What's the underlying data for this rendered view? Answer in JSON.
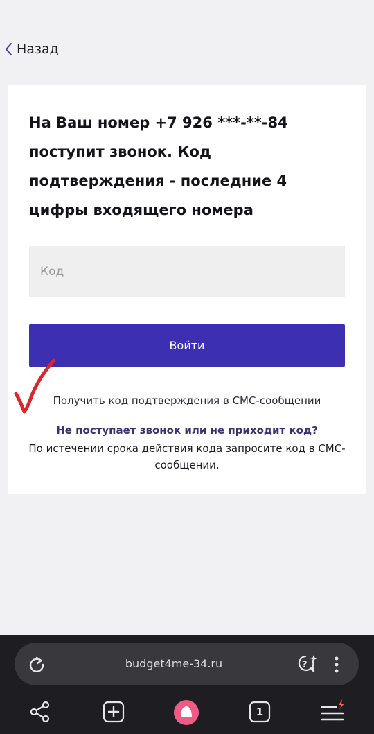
{
  "nav": {
    "back_label": "Назад"
  },
  "card": {
    "title": "На Ваш номер +7 926 ***-**-84 поступит звонок. Код подтверждения - последние 4 цифры входящего номера",
    "code_placeholder": "Код",
    "login_label": "Войти",
    "sms_link_label": "Получить код подтверждения в СМС-сообщении",
    "help_title": "Не поступает звонок или не приходит код?",
    "help_text": "По истечении срока действия кода запросите код в СМС-сообщении."
  },
  "browser": {
    "url": "budget4me-34.ru",
    "tabs_count": "1",
    "icons": [
      "reload-icon",
      "assistant-question-icon",
      "more-vertical-icon",
      "share-icon",
      "new-tab-icon",
      "alice-icon",
      "tabs-icon",
      "menu-icon"
    ]
  },
  "colors": {
    "accent": "#3c2fb1",
    "help_link": "#3b3173",
    "annotation": "#e0242b",
    "browser_bg": "#1e1e22",
    "alice": "#f05b86"
  }
}
